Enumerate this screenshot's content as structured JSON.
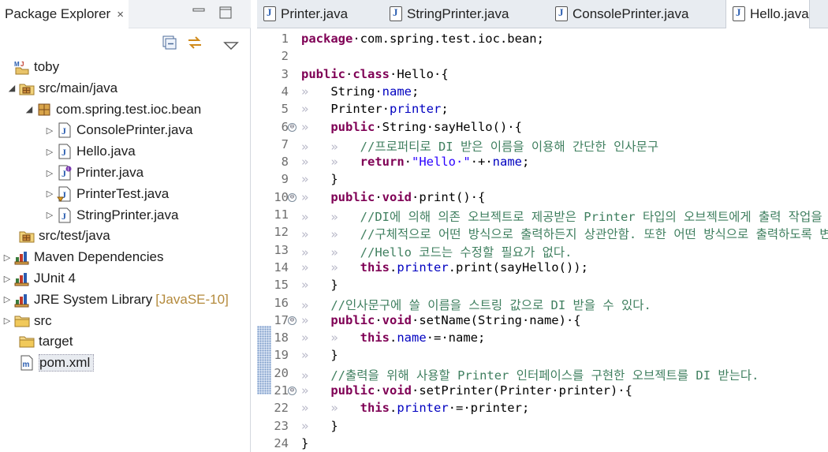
{
  "explorer": {
    "title": "Package Explorer",
    "close_glyph": "×",
    "tree": [
      {
        "label": "toby",
        "icon": "project-icon",
        "indent": 0,
        "twisty": ""
      },
      {
        "label": "src/main/java",
        "icon": "source-folder-icon",
        "indent": 1,
        "twisty": "◢"
      },
      {
        "label": "com.spring.test.ioc.bean",
        "icon": "package-icon",
        "indent": 2,
        "twisty": "◢"
      },
      {
        "label": "ConsolePrinter.java",
        "icon": "java-file-icon",
        "indent": 3,
        "twisty": "▷"
      },
      {
        "label": "Hello.java",
        "icon": "java-file-icon",
        "indent": 3,
        "twisty": "▷"
      },
      {
        "label": "Printer.java",
        "icon": "java-interface-file-icon",
        "indent": 3,
        "twisty": "▷"
      },
      {
        "label": "PrinterTest.java",
        "icon": "java-test-file-icon",
        "indent": 3,
        "twisty": "▷"
      },
      {
        "label": "StringPrinter.java",
        "icon": "java-file-icon",
        "indent": 3,
        "twisty": "▷"
      },
      {
        "label": "src/test/java",
        "icon": "source-folder-icon",
        "indent": 1,
        "twisty": ""
      },
      {
        "label": "Maven Dependencies",
        "icon": "library-icon",
        "indent": 0,
        "twisty": "▷"
      },
      {
        "label": "JUnit 4",
        "icon": "library-icon",
        "indent": 0,
        "twisty": "▷"
      },
      {
        "label": "JRE System Library",
        "icon": "library-icon",
        "indent": 0,
        "twisty": "▷",
        "decoration": "[JavaSE-10]"
      },
      {
        "label": "src",
        "icon": "folder-icon",
        "indent": 0,
        "twisty": "▷"
      },
      {
        "label": "target",
        "icon": "folder-icon",
        "indent": 1,
        "twisty": ""
      },
      {
        "label": "pom.xml",
        "icon": "xml-file-icon",
        "indent": 1,
        "twisty": "",
        "selected": true
      }
    ]
  },
  "editor": {
    "tabs": [
      {
        "label": "Printer.java",
        "active": false
      },
      {
        "label": "StringPrinter.java",
        "active": false
      },
      {
        "label": "ConsolePrinter.java",
        "active": false
      },
      {
        "label": "Hello.java",
        "active": true
      }
    ],
    "lines": [
      {
        "n": "1",
        "fold": "",
        "tokens": [
          [
            "kw",
            "package"
          ],
          [
            "",
            "·com.spring.test.ioc.bean;"
          ]
        ]
      },
      {
        "n": "2",
        "fold": "",
        "tokens": []
      },
      {
        "n": "3",
        "fold": "",
        "tokens": [
          [
            "kw",
            "public"
          ],
          [
            "",
            "·"
          ],
          [
            "kw",
            "class"
          ],
          [
            "",
            "·Hello·{"
          ]
        ]
      },
      {
        "n": "4",
        "fold": "",
        "tokens": [
          [
            "ws",
            "»   "
          ],
          [
            "",
            "String·"
          ],
          [
            "fd",
            "name"
          ],
          [
            "",
            ";"
          ]
        ]
      },
      {
        "n": "5",
        "fold": "",
        "tokens": [
          [
            "ws",
            "»   "
          ],
          [
            "",
            "Printer·"
          ],
          [
            "fd",
            "printer"
          ],
          [
            "",
            ";"
          ]
        ]
      },
      {
        "n": "6",
        "fold": "⊖",
        "tokens": [
          [
            "ws",
            "»   "
          ],
          [
            "kw",
            "public"
          ],
          [
            "",
            "·String·sayHello()·{"
          ]
        ]
      },
      {
        "n": "7",
        "fold": "",
        "tokens": [
          [
            "ws",
            "»   »   "
          ],
          [
            "cm",
            "//프로퍼티로 DI 받은 이름을 이용해 간단한 인사문구"
          ]
        ]
      },
      {
        "n": "8",
        "fold": "",
        "tokens": [
          [
            "ws",
            "»   »   "
          ],
          [
            "kw",
            "return"
          ],
          [
            "",
            "·"
          ],
          [
            "st",
            "\"Hello·\""
          ],
          [
            "",
            "·+·"
          ],
          [
            "fd",
            "name"
          ],
          [
            "",
            ";"
          ]
        ]
      },
      {
        "n": "9",
        "fold": "",
        "tokens": [
          [
            "ws",
            "»   "
          ],
          [
            "",
            "}"
          ]
        ]
      },
      {
        "n": "10",
        "fold": "⊖",
        "tokens": [
          [
            "ws",
            "»   "
          ],
          [
            "kw",
            "public"
          ],
          [
            "",
            "·"
          ],
          [
            "kw",
            "void"
          ],
          [
            "",
            "·print()·{"
          ]
        ]
      },
      {
        "n": "11",
        "fold": "",
        "tokens": [
          [
            "ws",
            "»   »   "
          ],
          [
            "cm",
            "//DI에 의해 의존 오브젝트로 제공받은 Printer 타입의 오브젝트에게 출력 작업을 위임."
          ]
        ]
      },
      {
        "n": "12",
        "fold": "",
        "tokens": [
          [
            "ws",
            "»   »   "
          ],
          [
            "cm",
            "//구체적으로 어떤 방식으로 출력하든지 상관안함. 또한 어떤 방식으로 출력하도록 변경해도"
          ]
        ]
      },
      {
        "n": "13",
        "fold": "",
        "tokens": [
          [
            "ws",
            "»   »   "
          ],
          [
            "cm",
            "//Hello 코드는 수정할 필요가 없다."
          ]
        ]
      },
      {
        "n": "14",
        "fold": "",
        "tokens": [
          [
            "ws",
            "»   »   "
          ],
          [
            "kw",
            "this"
          ],
          [
            "",
            "."
          ],
          [
            "fd",
            "printer"
          ],
          [
            "",
            ".print(sayHello());"
          ]
        ]
      },
      {
        "n": "15",
        "fold": "",
        "tokens": [
          [
            "ws",
            "»   "
          ],
          [
            "",
            "}"
          ]
        ]
      },
      {
        "n": "16",
        "fold": "",
        "tokens": [
          [
            "ws",
            "»   "
          ],
          [
            "cm",
            "//인사문구에 쓸 이름을 스트링 값으로 DI 받을 수 있다."
          ]
        ]
      },
      {
        "n": "17",
        "fold": "⊖",
        "tokens": [
          [
            "ws",
            "»   "
          ],
          [
            "kw",
            "public"
          ],
          [
            "",
            "·"
          ],
          [
            "kw",
            "void"
          ],
          [
            "",
            "·setName(String·name)·{"
          ]
        ]
      },
      {
        "n": "18",
        "fold": "",
        "tokens": [
          [
            "ws",
            "»   »   "
          ],
          [
            "kw",
            "this"
          ],
          [
            "",
            "."
          ],
          [
            "fd",
            "name"
          ],
          [
            "",
            "·=·name;"
          ]
        ]
      },
      {
        "n": "19",
        "fold": "",
        "tokens": [
          [
            "ws",
            "»   "
          ],
          [
            "",
            "}"
          ]
        ]
      },
      {
        "n": "20",
        "fold": "",
        "tokens": [
          [
            "ws",
            "»   "
          ],
          [
            "cm",
            "//출력을 위해 사용할 Printer 인터페이스를 구현한 오브젝트를 DI 받는다."
          ]
        ]
      },
      {
        "n": "21",
        "fold": "⊖",
        "tokens": [
          [
            "ws",
            "»   "
          ],
          [
            "kw",
            "public"
          ],
          [
            "",
            "·"
          ],
          [
            "kw",
            "void"
          ],
          [
            "",
            "·setPrinter(Printer·printer)·{"
          ]
        ]
      },
      {
        "n": "22",
        "fold": "",
        "tokens": [
          [
            "ws",
            "»   »   "
          ],
          [
            "kw",
            "this"
          ],
          [
            "",
            "."
          ],
          [
            "fd",
            "printer"
          ],
          [
            "",
            "·=·printer;"
          ]
        ]
      },
      {
        "n": "23",
        "fold": "",
        "tokens": [
          [
            "ws",
            "»   "
          ],
          [
            "",
            "}"
          ]
        ]
      },
      {
        "n": "24",
        "fold": "",
        "tokens": [
          [
            "",
            "}"
          ]
        ]
      }
    ]
  },
  "colors": {
    "keyword": "#7f0055",
    "field": "#0000c0",
    "string": "#2a00ff",
    "comment": "#3f7f5f"
  }
}
